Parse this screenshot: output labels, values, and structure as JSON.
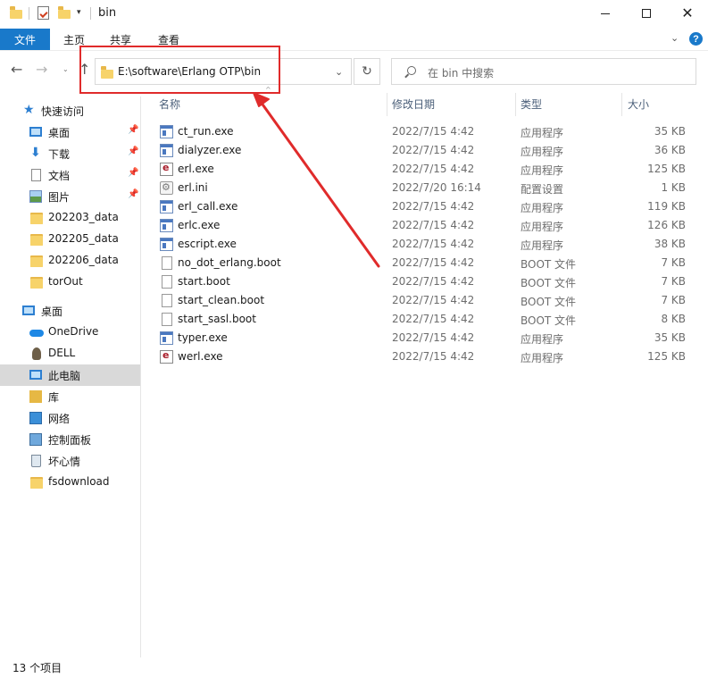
{
  "window": {
    "title": "bin",
    "minimize_label": "",
    "maximize_label": "",
    "close_label": "✕"
  },
  "quick_access_toolbar": {
    "dropdown_glyph": "▾"
  },
  "ribbon": {
    "tabs": [
      "文件",
      "主页",
      "共享",
      "查看"
    ],
    "expand_glyph": "⌄",
    "help_glyph": "?"
  },
  "navigation": {
    "back_glyph": "←",
    "forward_glyph": "→",
    "recent_glyph": "⌄",
    "up_glyph": "↑",
    "address_path": "E:\\software\\Erlang OTP\\bin",
    "address_dropdown_glyph": "⌄",
    "refresh_glyph": "↻",
    "search_placeholder": "在 bin 中搜索"
  },
  "sidebar": {
    "items": [
      {
        "label": "快速访问",
        "icon": "star-icon"
      },
      {
        "label": "桌面",
        "icon": "desktop-icon",
        "pinned": true
      },
      {
        "label": "下载",
        "icon": "download-icon",
        "pinned": true
      },
      {
        "label": "文档",
        "icon": "document-icon",
        "pinned": true
      },
      {
        "label": "图片",
        "icon": "pictures-icon",
        "pinned": true
      },
      {
        "label": "202203_data",
        "icon": "folder-icon"
      },
      {
        "label": "202205_data",
        "icon": "folder-icon"
      },
      {
        "label": "202206_data",
        "icon": "folder-icon"
      },
      {
        "label": "torOut",
        "icon": "folder-icon"
      },
      {
        "label": "桌面",
        "icon": "desktop-icon"
      },
      {
        "label": "OneDrive",
        "icon": "onedrive-icon"
      },
      {
        "label": "DELL",
        "icon": "user-icon"
      },
      {
        "label": "此电脑",
        "icon": "this-pc-icon",
        "selected": true
      },
      {
        "label": "库",
        "icon": "library-icon"
      },
      {
        "label": "网络",
        "icon": "network-icon"
      },
      {
        "label": "控制面板",
        "icon": "control-panel-icon"
      },
      {
        "label": "坏心情",
        "icon": "recycle-bin-icon"
      },
      {
        "label": "fsdownload",
        "icon": "folder-icon"
      }
    ],
    "pin_glyph": "📌"
  },
  "file_list": {
    "columns": [
      "名称",
      "修改日期",
      "类型",
      "大小"
    ],
    "sort_glyph": "^",
    "rows": [
      {
        "name": "ct_run.exe",
        "date": "2022/7/15 4:42",
        "type": "应用程序",
        "size": "35 KB",
        "icon": "application-icon"
      },
      {
        "name": "dialyzer.exe",
        "date": "2022/7/15 4:42",
        "type": "应用程序",
        "size": "36 KB",
        "icon": "application-icon"
      },
      {
        "name": "erl.exe",
        "date": "2022/7/15 4:42",
        "type": "应用程序",
        "size": "125 KB",
        "icon": "erlang-icon"
      },
      {
        "name": "erl.ini",
        "date": "2022/7/20 16:14",
        "type": "配置设置",
        "size": "1 KB",
        "icon": "config-icon"
      },
      {
        "name": "erl_call.exe",
        "date": "2022/7/15 4:42",
        "type": "应用程序",
        "size": "119 KB",
        "icon": "application-icon"
      },
      {
        "name": "erlc.exe",
        "date": "2022/7/15 4:42",
        "type": "应用程序",
        "size": "126 KB",
        "icon": "application-icon"
      },
      {
        "name": "escript.exe",
        "date": "2022/7/15 4:42",
        "type": "应用程序",
        "size": "38 KB",
        "icon": "application-icon"
      },
      {
        "name": "no_dot_erlang.boot",
        "date": "2022/7/15 4:42",
        "type": "BOOT 文件",
        "size": "7 KB",
        "icon": "file-icon"
      },
      {
        "name": "start.boot",
        "date": "2022/7/15 4:42",
        "type": "BOOT 文件",
        "size": "7 KB",
        "icon": "file-icon"
      },
      {
        "name": "start_clean.boot",
        "date": "2022/7/15 4:42",
        "type": "BOOT 文件",
        "size": "7 KB",
        "icon": "file-icon"
      },
      {
        "name": "start_sasl.boot",
        "date": "2022/7/15 4:42",
        "type": "BOOT 文件",
        "size": "8 KB",
        "icon": "file-icon"
      },
      {
        "name": "typer.exe",
        "date": "2022/7/15 4:42",
        "type": "应用程序",
        "size": "35 KB",
        "icon": "application-icon"
      },
      {
        "name": "werl.exe",
        "date": "2022/7/15 4:42",
        "type": "应用程序",
        "size": "125 KB",
        "icon": "erlang-icon"
      }
    ]
  },
  "status_bar": {
    "item_count": "13 个项目"
  },
  "colors": {
    "accent": "#1979ca",
    "annotation": "#e02b2b",
    "selected_bg": "#d9d9d9"
  }
}
